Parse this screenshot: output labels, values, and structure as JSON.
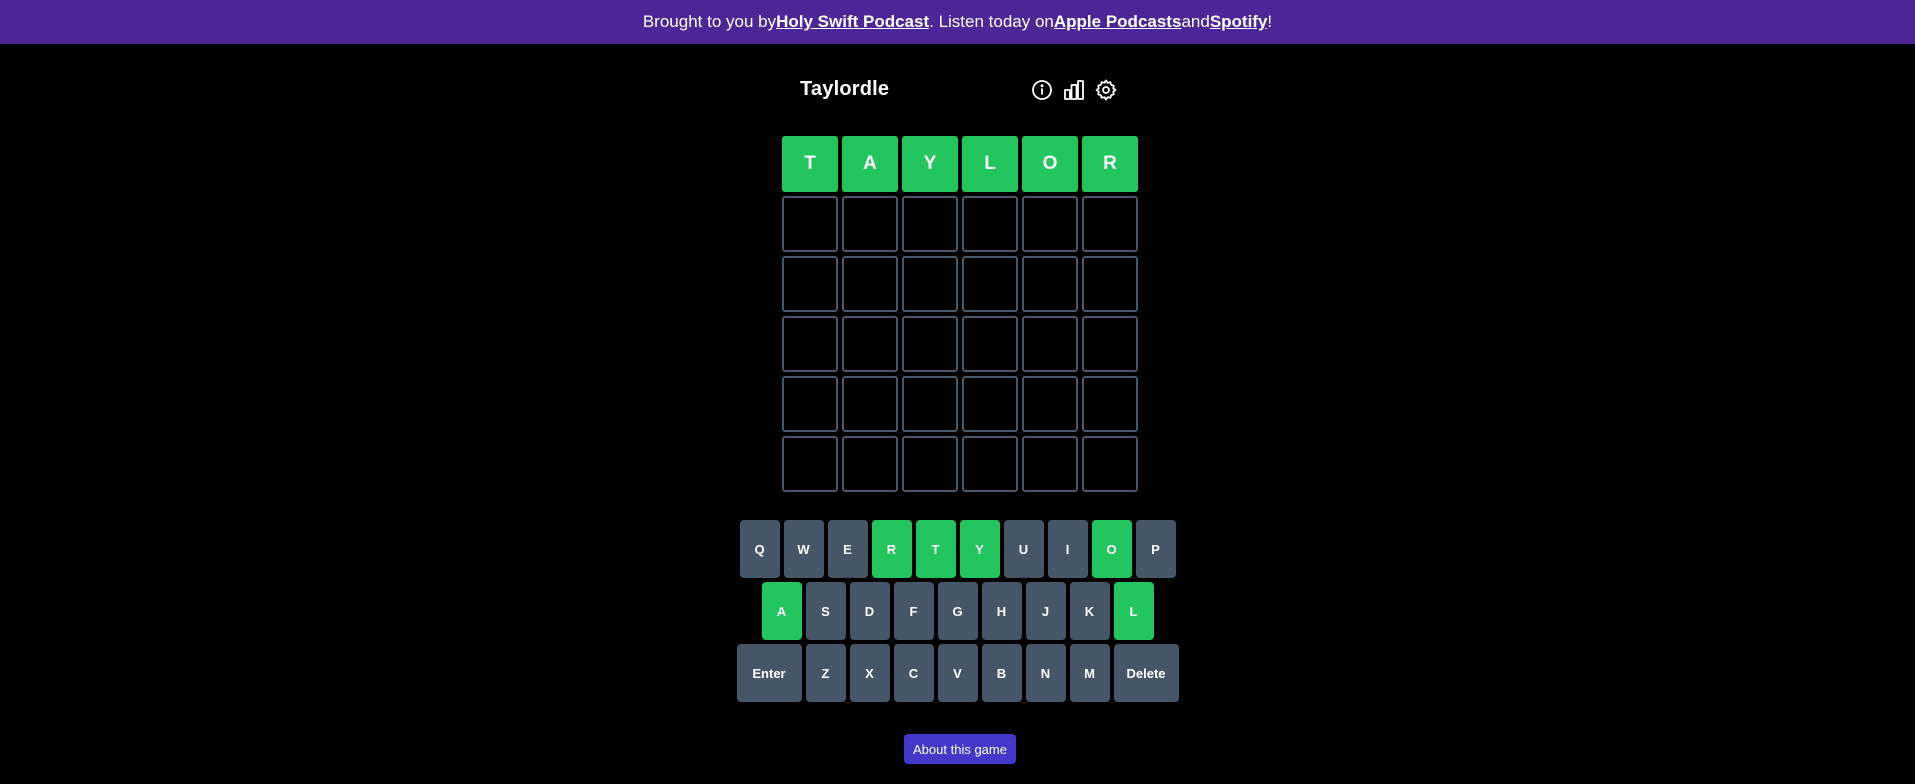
{
  "banner": {
    "prefix": "Brought to you by ",
    "podcast_link": "Holy Swift Podcast",
    "middle": ". Listen today on ",
    "apple_link": "Apple Podcasts",
    "and": " and ",
    "spotify_link": "Spotify",
    "suffix": "!"
  },
  "header": {
    "title": "Taylordle",
    "icons": [
      "info-icon",
      "stats-icon",
      "settings-icon"
    ]
  },
  "board": {
    "rows": [
      [
        "T",
        "A",
        "Y",
        "L",
        "O",
        "R"
      ],
      [
        "",
        "",
        "",
        "",
        "",
        ""
      ],
      [
        "",
        "",
        "",
        "",
        "",
        ""
      ],
      [
        "",
        "",
        "",
        "",
        "",
        ""
      ],
      [
        "",
        "",
        "",
        "",
        "",
        ""
      ],
      [
        "",
        "",
        "",
        "",
        "",
        ""
      ]
    ],
    "states": [
      [
        "correct",
        "correct",
        "correct",
        "correct",
        "correct",
        "correct"
      ],
      [
        "empty",
        "empty",
        "empty",
        "empty",
        "empty",
        "empty"
      ],
      [
        "empty",
        "empty",
        "empty",
        "empty",
        "empty",
        "empty"
      ],
      [
        "empty",
        "empty",
        "empty",
        "empty",
        "empty",
        "empty"
      ],
      [
        "empty",
        "empty",
        "empty",
        "empty",
        "empty",
        "empty"
      ],
      [
        "empty",
        "empty",
        "empty",
        "empty",
        "empty",
        "empty"
      ]
    ]
  },
  "keyboard": {
    "rows": [
      [
        {
          "label": "Q",
          "state": "none"
        },
        {
          "label": "W",
          "state": "none"
        },
        {
          "label": "E",
          "state": "none"
        },
        {
          "label": "R",
          "state": "correct"
        },
        {
          "label": "T",
          "state": "correct"
        },
        {
          "label": "Y",
          "state": "correct"
        },
        {
          "label": "U",
          "state": "none"
        },
        {
          "label": "I",
          "state": "none"
        },
        {
          "label": "O",
          "state": "correct"
        },
        {
          "label": "P",
          "state": "none"
        }
      ],
      [
        {
          "label": "A",
          "state": "correct"
        },
        {
          "label": "S",
          "state": "none"
        },
        {
          "label": "D",
          "state": "none"
        },
        {
          "label": "F",
          "state": "none"
        },
        {
          "label": "G",
          "state": "none"
        },
        {
          "label": "H",
          "state": "none"
        },
        {
          "label": "J",
          "state": "none"
        },
        {
          "label": "K",
          "state": "none"
        },
        {
          "label": "L",
          "state": "correct"
        }
      ],
      [
        {
          "label": "Enter",
          "state": "none",
          "wide": true
        },
        {
          "label": "Z",
          "state": "none"
        },
        {
          "label": "X",
          "state": "none"
        },
        {
          "label": "C",
          "state": "none"
        },
        {
          "label": "V",
          "state": "none"
        },
        {
          "label": "B",
          "state": "none"
        },
        {
          "label": "N",
          "state": "none"
        },
        {
          "label": "M",
          "state": "none"
        },
        {
          "label": "Delete",
          "state": "none",
          "wide": true
        }
      ]
    ]
  },
  "footer": {
    "about_label": "About this game"
  },
  "colors": {
    "banner": "#4c2596",
    "correct": "#22c55e",
    "key": "#475569",
    "cell_border": "#475569",
    "about_button": "#4338ca"
  }
}
